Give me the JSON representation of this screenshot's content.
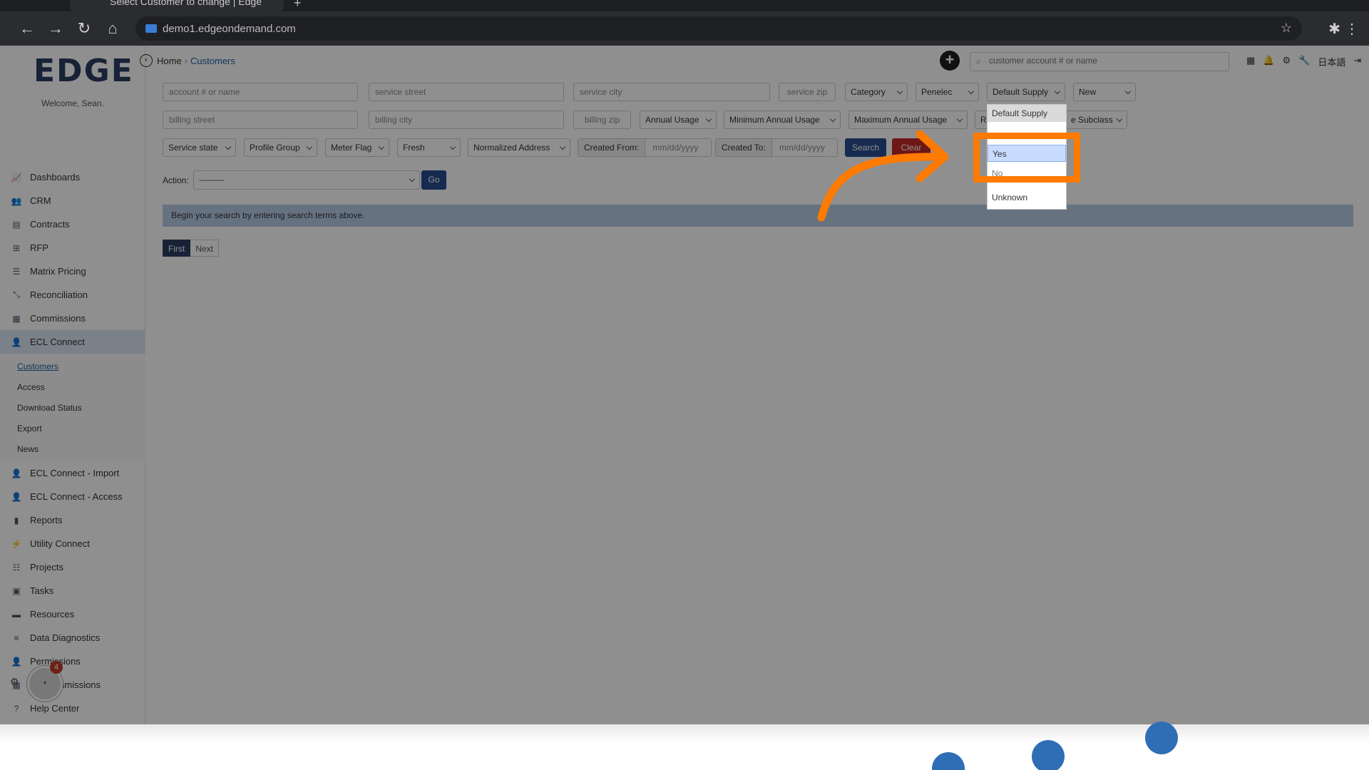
{
  "browser": {
    "tab_title": "Select Customer to change | Edge",
    "url": "demo1.edgeondemand.com"
  },
  "app": {
    "logo": "EDGE",
    "welcome": "Welcome, Sean."
  },
  "sidebar": {
    "items": [
      {
        "label": "Dashboards",
        "icon": "chart-line-icon"
      },
      {
        "label": "CRM",
        "icon": "users-icon"
      },
      {
        "label": "Contracts",
        "icon": "document-icon"
      },
      {
        "label": "RFP",
        "icon": "sitemap-icon"
      },
      {
        "label": "Matrix Pricing",
        "icon": "list-icon"
      },
      {
        "label": "Reconciliation",
        "icon": "compress-icon"
      },
      {
        "label": "Commissions",
        "icon": "money-icon"
      },
      {
        "label": "ECL Connect",
        "icon": "user-connect-icon"
      }
    ],
    "sub_items": [
      "Customers",
      "Access",
      "Download Status",
      "Export",
      "News"
    ],
    "items_after": [
      {
        "label": "ECL Connect - Import",
        "icon": "user-connect-icon"
      },
      {
        "label": "ECL Connect - Access",
        "icon": "user-connect-icon"
      },
      {
        "label": "Reports",
        "icon": "bar-chart-icon"
      },
      {
        "label": "Utility Connect",
        "icon": "plug-icon"
      },
      {
        "label": "Projects",
        "icon": "tasks-icon"
      },
      {
        "label": "Tasks",
        "icon": "book-icon"
      },
      {
        "label": "Resources",
        "icon": "folder-icon"
      },
      {
        "label": "Data Diagnostics",
        "icon": "database-icon"
      },
      {
        "label": "Permissions",
        "icon": "user-lock-icon"
      },
      {
        "label": "My Commissions",
        "icon": "money-icon"
      },
      {
        "label": "Help Center",
        "icon": "question-icon"
      }
    ],
    "notification_count": "4"
  },
  "header": {
    "breadcrumb_home": "Home",
    "breadcrumb_current": "Customers",
    "search_placeholder": "customer account # or name",
    "language": "日本語"
  },
  "filters": {
    "account_placeholder": "account # or name",
    "service_street_placeholder": "service street",
    "service_city_placeholder": "service city",
    "service_zip_placeholder": "service zip",
    "category": "Category",
    "utility": "Penelec",
    "default_supply": "Default Supply",
    "new": "New",
    "billing_street_placeholder": "billing street",
    "billing_city_placeholder": "billing city",
    "billing_zip_placeholder": "billing zip",
    "annual_usage": "Annual Usage",
    "min_annual_usage": "Minimum Annual Usage",
    "max_annual_usage": "Maximum Annual Usage",
    "rate_class_partial": "R",
    "subclass_partial": "e Subclass",
    "service_state": "Service state",
    "profile_group": "Profile Group",
    "meter_flag": "Meter Flag",
    "fresh": "Fresh",
    "normalized_address": "Normalized Address",
    "created_from_label": "Created From:",
    "created_from_placeholder": "mm/dd/yyyy",
    "created_to_label": "Created To:",
    "created_to_placeholder": "mm/dd/yyyy",
    "search_button": "Search",
    "clear_button": "Clear"
  },
  "actions": {
    "label": "Action:",
    "selected": "---------",
    "go_button": "Go"
  },
  "results": {
    "message": "Begin your search by entering search terms above.",
    "first": "First",
    "next": "Next"
  },
  "dropdown": {
    "options": [
      "Default Supply",
      "Yes",
      "No",
      "Unknown"
    ],
    "selected": "Yes"
  },
  "colors": {
    "highlight": "#ff7a00",
    "brand_navy": "#2c3e63",
    "search_blue": "#2a4d8f",
    "clear_red": "#c62828"
  }
}
